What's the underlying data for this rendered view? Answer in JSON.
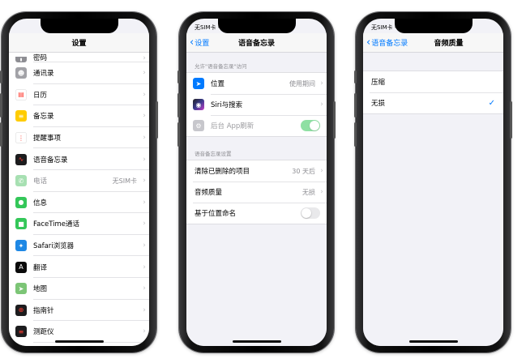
{
  "status": {
    "carrier": "无SIM卡"
  },
  "phone1": {
    "title": "设置",
    "items": [
      {
        "label": "密码",
        "icon": "passcode-icon",
        "color": "#8e8e93",
        "glyph": "▮",
        "value": ""
      },
      {
        "label": "通讯录",
        "icon": "contacts-icon",
        "color": "#a2a2a7",
        "glyph": "☻",
        "value": ""
      },
      {
        "label": "日历",
        "icon": "calendar-icon",
        "color": "#ffffff",
        "glyph": "▤",
        "value": ""
      },
      {
        "label": "备忘录",
        "icon": "notes-icon",
        "color": "#ffcc00",
        "glyph": "≡",
        "value": ""
      },
      {
        "label": "提醒事项",
        "icon": "reminders-icon",
        "color": "#ffffff",
        "glyph": "⋮",
        "value": ""
      },
      {
        "label": "语音备忘录",
        "icon": "voice-memos-icon",
        "color": "#1c1c1e",
        "glyph": "∿",
        "value": ""
      },
      {
        "label": "电话",
        "icon": "phone-icon",
        "color": "#a7e0b2",
        "glyph": "✆",
        "value": "无SIM卡",
        "dim": true
      },
      {
        "label": "信息",
        "icon": "messages-icon",
        "color": "#34c759",
        "glyph": "●",
        "value": ""
      },
      {
        "label": "FaceTime通话",
        "icon": "facetime-icon",
        "color": "#34c759",
        "glyph": "■",
        "value": ""
      },
      {
        "label": "Safari浏览器",
        "icon": "safari-icon",
        "color": "#1e88e5",
        "glyph": "✦",
        "value": ""
      },
      {
        "label": "翻译",
        "icon": "translate-icon",
        "color": "#0a0a0a",
        "glyph": "A",
        "value": ""
      },
      {
        "label": "地图",
        "icon": "maps-icon",
        "color": "#7cc576",
        "glyph": "➤",
        "value": ""
      },
      {
        "label": "指南针",
        "icon": "compass-icon",
        "color": "#1c1c1e",
        "glyph": "⊕",
        "value": ""
      },
      {
        "label": "测距仪",
        "icon": "measure-icon",
        "color": "#1c1c1e",
        "glyph": "≡",
        "value": ""
      }
    ]
  },
  "phone2": {
    "back": "设置",
    "title": "语音备忘录",
    "section1_header": "允许\"语音备忘录\"访问",
    "location": {
      "label": "位置",
      "value": "使用期间"
    },
    "siri": {
      "label": "Siri与搜索"
    },
    "background_refresh": {
      "label": "后台 App刷新"
    },
    "section2_header": "语音备忘录设置",
    "clear_deleted": {
      "label": "清除已删除的项目",
      "value": "30 天后"
    },
    "audio_quality": {
      "label": "音频质量",
      "value": "无损"
    },
    "location_naming": {
      "label": "基于位置命名"
    }
  },
  "phone3": {
    "back": "语音备忘录",
    "title": "音频质量",
    "options": [
      "压缩",
      "无损"
    ],
    "selected": "无损"
  },
  "colors": {
    "accent": "#007aff",
    "toggle_on": "#34c759"
  }
}
